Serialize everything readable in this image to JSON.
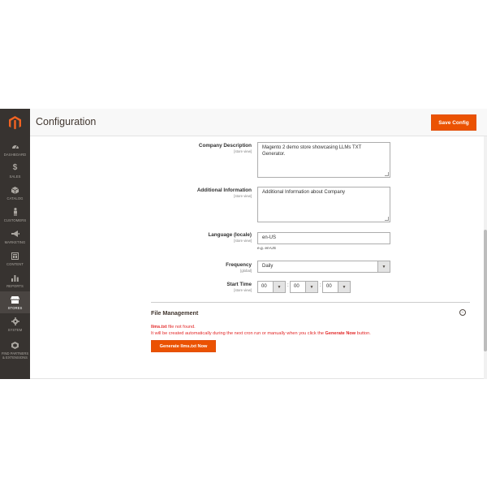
{
  "header": {
    "title": "Configuration",
    "save_label": "Save Config"
  },
  "sidebar": {
    "items": [
      {
        "label": "DASHBOARD",
        "icon": "dashboard-icon"
      },
      {
        "label": "SALES",
        "icon": "dollar-icon"
      },
      {
        "label": "CATALOG",
        "icon": "box-icon"
      },
      {
        "label": "CUSTOMERS",
        "icon": "person-icon"
      },
      {
        "label": "MARKETING",
        "icon": "megaphone-icon"
      },
      {
        "label": "CONTENT",
        "icon": "layout-icon"
      },
      {
        "label": "REPORTS",
        "icon": "bar-chart-icon"
      },
      {
        "label": "STORES",
        "icon": "store-icon"
      },
      {
        "label": "SYSTEM",
        "icon": "gear-icon"
      },
      {
        "label_line1": "FIND PARTNERS",
        "label_line2": "& EXTENSIONS",
        "icon": "partners-icon"
      }
    ]
  },
  "form": {
    "company_description": {
      "label": "Company Description",
      "scope": "[store view]",
      "value": "Magento 2 demo store showcasing LLMs TXT Generator."
    },
    "additional_information": {
      "label": "Additional Information",
      "scope": "[store view]",
      "value": "Additional Information about Company"
    },
    "language": {
      "label": "Language (locale)",
      "scope": "[store view]",
      "value": "en-US",
      "note": "e.g. en-US"
    },
    "frequency": {
      "label": "Frequency",
      "scope": "[global]",
      "value": "Daily"
    },
    "start_time": {
      "label": "Start Time",
      "scope": "[store view]",
      "hour": "00",
      "minute": "00",
      "second": "00",
      "separator": ":"
    }
  },
  "file_management": {
    "title": "File Management",
    "filename": "llms.txt",
    "not_found_text": " file not found.",
    "message_prefix": "It will be created automatically during the next cron run or manually when you click the ",
    "message_bold": "Generate Now",
    "message_suffix": " button.",
    "button_label": "Generate llms.txt Now"
  },
  "colors": {
    "accent": "#eb5202",
    "sidebar_bg": "#373330",
    "error_text": "#e22626"
  }
}
